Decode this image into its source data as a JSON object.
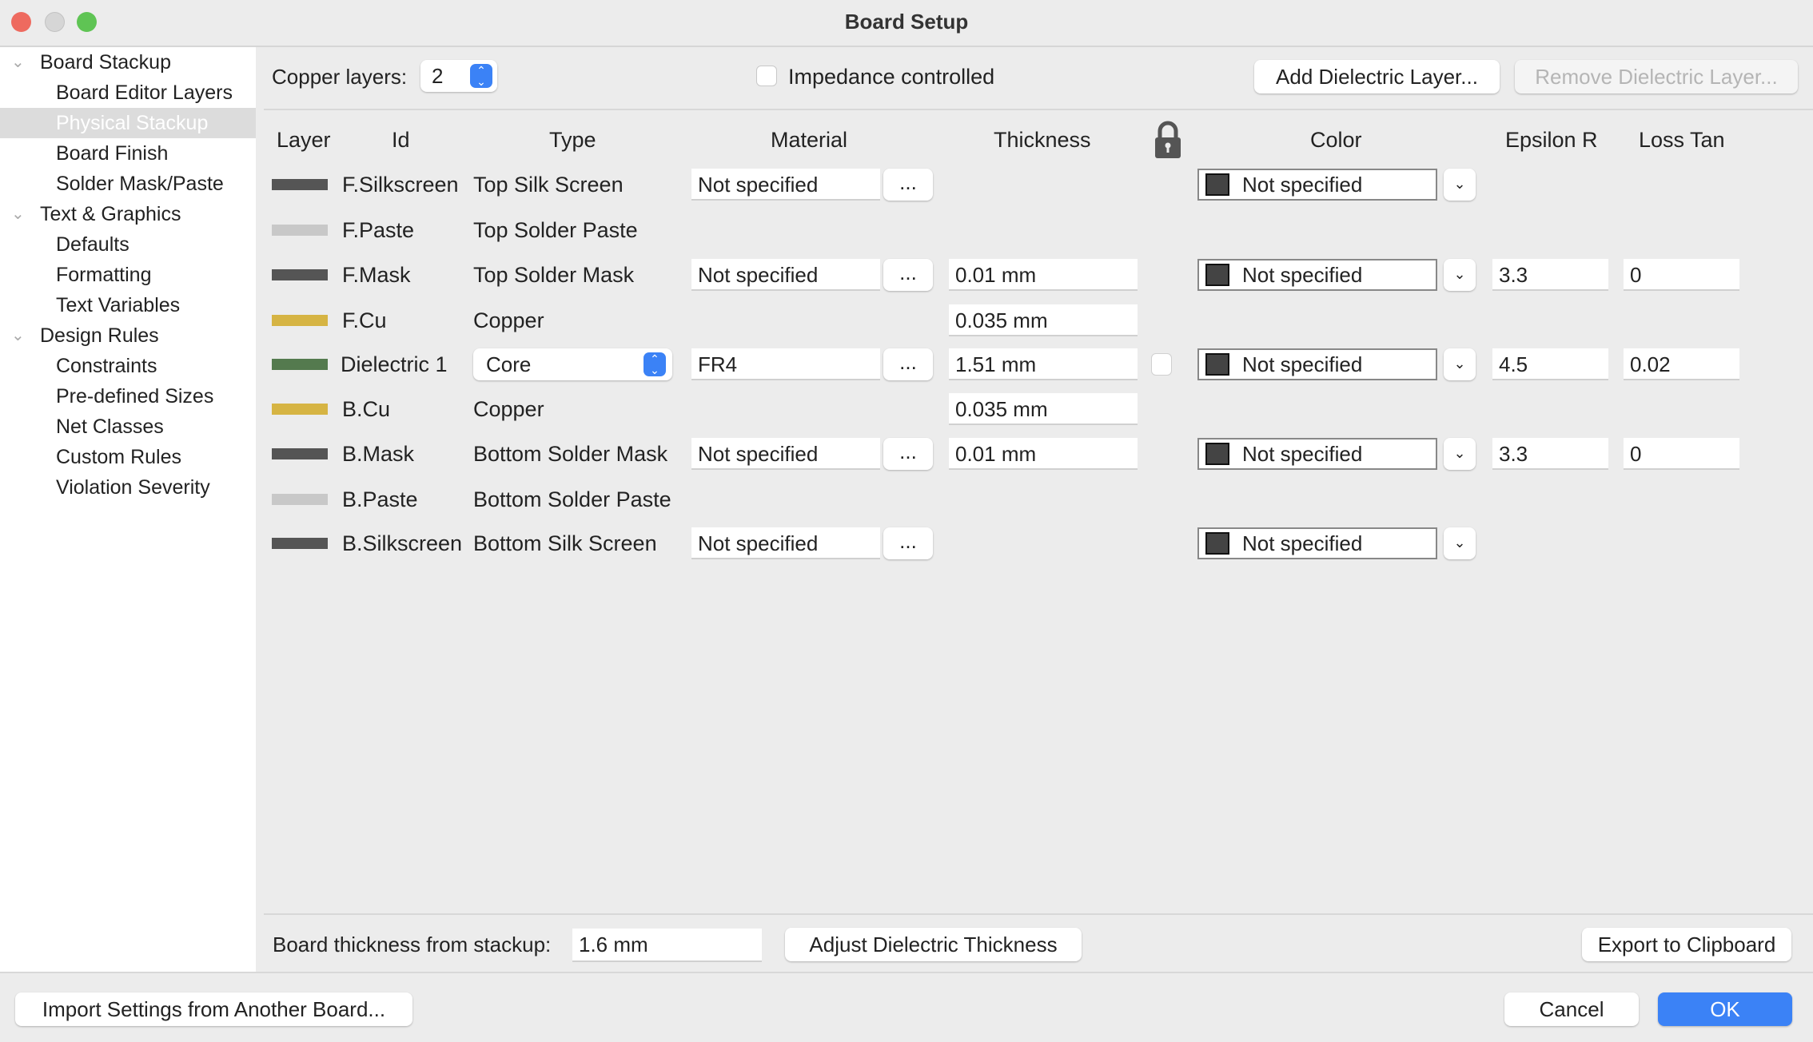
{
  "window": {
    "title": "Board Setup"
  },
  "sidebar": {
    "items": [
      {
        "label": "Board Stackup",
        "level": 0,
        "expanded": true
      },
      {
        "label": "Board Editor Layers",
        "level": 1
      },
      {
        "label": "Physical Stackup",
        "level": 1,
        "selected": true
      },
      {
        "label": "Board Finish",
        "level": 1
      },
      {
        "label": "Solder Mask/Paste",
        "level": 1
      },
      {
        "label": "Text & Graphics",
        "level": 0,
        "expanded": true
      },
      {
        "label": "Defaults",
        "level": 1
      },
      {
        "label": "Formatting",
        "level": 1
      },
      {
        "label": "Text Variables",
        "level": 1
      },
      {
        "label": "Design Rules",
        "level": 0,
        "expanded": true
      },
      {
        "label": "Constraints",
        "level": 1
      },
      {
        "label": "Pre-defined Sizes",
        "level": 1
      },
      {
        "label": "Net Classes",
        "level": 1
      },
      {
        "label": "Custom Rules",
        "level": 1
      },
      {
        "label": "Violation Severity",
        "level": 1
      }
    ]
  },
  "toolbar": {
    "copper_layers_label": "Copper layers:",
    "copper_layers_value": "2",
    "impedance_label": "Impedance controlled",
    "impedance_checked": false,
    "add_dielectric_label": "Add Dielectric Layer...",
    "remove_dielectric_label": "Remove Dielectric Layer..."
  },
  "table": {
    "headers": {
      "layer": "Layer",
      "id": "Id",
      "type": "Type",
      "material": "Material",
      "thickness": "Thickness",
      "color": "Color",
      "epsilon": "Epsilon R",
      "loss": "Loss Tan"
    },
    "rows": [
      {
        "swatch": "#555555",
        "id": "F.Silkscreen",
        "type": "Top Silk Screen",
        "material": "Not specified",
        "thickness": null,
        "color": "Not specified",
        "epsilon": null,
        "loss": null
      },
      {
        "swatch": "#c8c8c8",
        "id": "F.Paste",
        "type": "Top Solder Paste",
        "material": null,
        "thickness": null,
        "color": null,
        "epsilon": null,
        "loss": null
      },
      {
        "swatch": "#555555",
        "id": "F.Mask",
        "type": "Top Solder Mask",
        "material": "Not specified",
        "thickness": "0.01 mm",
        "color": "Not specified",
        "epsilon": "3.3",
        "loss": "0"
      },
      {
        "swatch": "#d6b443",
        "id": "F.Cu",
        "type": "Copper",
        "material": null,
        "thickness": "0.035 mm",
        "color": null,
        "epsilon": null,
        "loss": null
      },
      {
        "swatch": "#547a4e",
        "id": "Dielectric 1",
        "type": "Core",
        "type_is_select": true,
        "material": "FR4",
        "thickness": "1.51 mm",
        "lock_checkbox": true,
        "color": "Not specified",
        "epsilon": "4.5",
        "loss": "0.02"
      },
      {
        "swatch": "#d6b443",
        "id": "B.Cu",
        "type": "Copper",
        "material": null,
        "thickness": "0.035 mm",
        "color": null,
        "epsilon": null,
        "loss": null
      },
      {
        "swatch": "#555555",
        "id": "B.Mask",
        "type": "Bottom Solder Mask",
        "material": "Not specified",
        "thickness": "0.01 mm",
        "color": "Not specified",
        "epsilon": "3.3",
        "loss": "0"
      },
      {
        "swatch": "#c8c8c8",
        "id": "B.Paste",
        "type": "Bottom Solder Paste",
        "material": null,
        "thickness": null,
        "color": null,
        "epsilon": null,
        "loss": null
      },
      {
        "swatch": "#555555",
        "id": "B.Silkscreen",
        "type": "Bottom Silk Screen",
        "material": "Not specified",
        "thickness": null,
        "color": "Not specified",
        "epsilon": null,
        "loss": null
      }
    ],
    "dots_label": "...",
    "color_chevron": "⌄"
  },
  "bottom": {
    "board_thickness_label": "Board thickness from stackup:",
    "board_thickness_value": "1.6 mm",
    "adjust_label": "Adjust Dielectric Thickness",
    "export_label": "Export to Clipboard"
  },
  "footer": {
    "import_label": "Import Settings from Another Board...",
    "cancel_label": "Cancel",
    "ok_label": "OK"
  },
  "colors": {
    "accent": "#3b82f6",
    "close": "#ee6a5f",
    "minimize": "#d6d6d6",
    "zoom": "#5fc454"
  }
}
